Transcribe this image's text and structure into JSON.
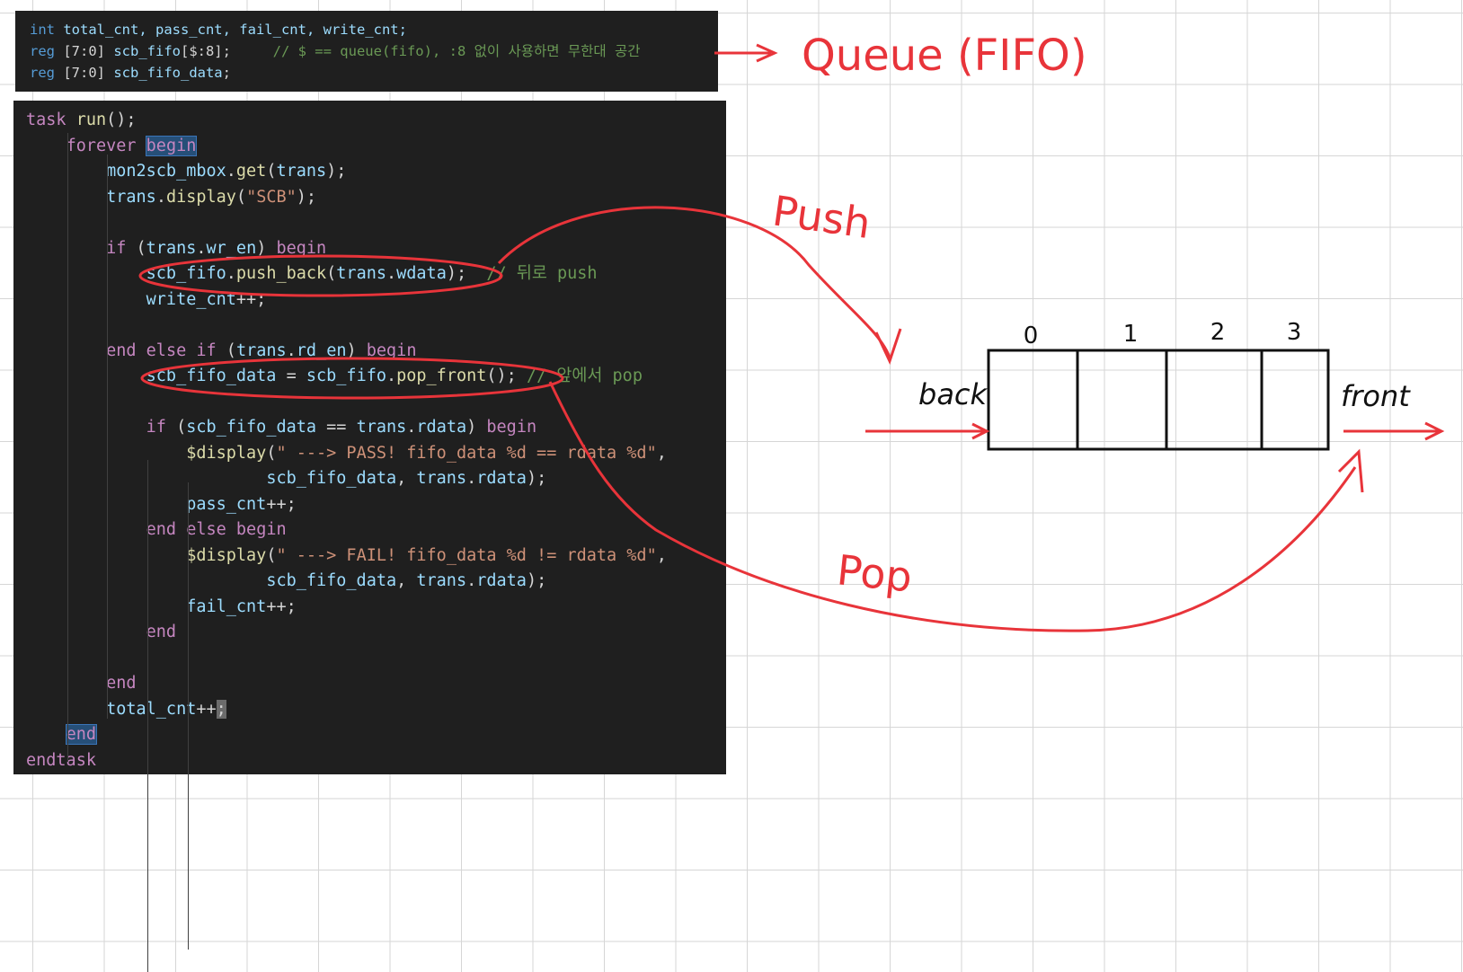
{
  "declarations": [
    [
      {
        "c": "kw",
        "t": "int"
      },
      {
        "c": "id",
        "t": " total_cnt, pass_cnt, fail_cnt, write_cnt;"
      }
    ],
    [
      {
        "c": "kw",
        "t": "reg"
      },
      {
        "c": "",
        "t": " [7:0] "
      },
      {
        "c": "id",
        "t": "scb_fifo"
      },
      {
        "c": "",
        "t": "[$:8];     "
      },
      {
        "c": "cm",
        "t": "// $ == queue(fifo), :8 없이 사용하면 무한대 공간"
      }
    ],
    [
      {
        "c": "kw",
        "t": "reg"
      },
      {
        "c": "",
        "t": " [7:0] "
      },
      {
        "c": "id",
        "t": "scb_fifo_data"
      },
      {
        "c": "",
        "t": ";"
      }
    ]
  ],
  "code_lines": [
    [
      {
        "c": "ctl",
        "t": "task"
      },
      {
        "c": "fn",
        "t": " run"
      },
      {
        "c": "",
        "t": "();"
      }
    ],
    [
      {
        "c": "",
        "t": "    "
      },
      {
        "c": "ctl",
        "t": "forever"
      },
      {
        "c": "",
        "t": " "
      },
      {
        "c": "ctl hl",
        "t": "begin"
      }
    ],
    [
      {
        "c": "",
        "t": "        "
      },
      {
        "c": "id",
        "t": "mon2scb_mbox"
      },
      {
        "c": "",
        "t": "."
      },
      {
        "c": "fn",
        "t": "get"
      },
      {
        "c": "",
        "t": "("
      },
      {
        "c": "id",
        "t": "trans"
      },
      {
        "c": "",
        "t": ");"
      }
    ],
    [
      {
        "c": "",
        "t": "        "
      },
      {
        "c": "id",
        "t": "trans"
      },
      {
        "c": "",
        "t": "."
      },
      {
        "c": "fn",
        "t": "display"
      },
      {
        "c": "",
        "t": "("
      },
      {
        "c": "str",
        "t": "\"SCB\""
      },
      {
        "c": "",
        "t": ");"
      }
    ],
    [],
    [
      {
        "c": "",
        "t": "        "
      },
      {
        "c": "ctl",
        "t": "if"
      },
      {
        "c": "",
        "t": " ("
      },
      {
        "c": "id",
        "t": "trans"
      },
      {
        "c": "",
        "t": "."
      },
      {
        "c": "id",
        "t": "wr_en"
      },
      {
        "c": "",
        "t": ") "
      },
      {
        "c": "ctl",
        "t": "begin"
      }
    ],
    [
      {
        "c": "",
        "t": "            "
      },
      {
        "c": "id",
        "t": "scb_fifo"
      },
      {
        "c": "",
        "t": "."
      },
      {
        "c": "fn",
        "t": "push_back"
      },
      {
        "c": "",
        "t": "("
      },
      {
        "c": "id",
        "t": "trans"
      },
      {
        "c": "",
        "t": "."
      },
      {
        "c": "id",
        "t": "wdata"
      },
      {
        "c": "",
        "t": ");  "
      },
      {
        "c": "cm",
        "t": "// 뒤로 push"
      }
    ],
    [
      {
        "c": "",
        "t": "            "
      },
      {
        "c": "id",
        "t": "write_cnt"
      },
      {
        "c": "",
        "t": "++;"
      }
    ],
    [],
    [
      {
        "c": "",
        "t": "        "
      },
      {
        "c": "ctl",
        "t": "end"
      },
      {
        "c": "",
        "t": " "
      },
      {
        "c": "ctl",
        "t": "else"
      },
      {
        "c": "",
        "t": " "
      },
      {
        "c": "ctl",
        "t": "if"
      },
      {
        "c": "",
        "t": " ("
      },
      {
        "c": "id",
        "t": "trans"
      },
      {
        "c": "",
        "t": "."
      },
      {
        "c": "id",
        "t": "rd_en"
      },
      {
        "c": "",
        "t": ") "
      },
      {
        "c": "ctl",
        "t": "begin"
      }
    ],
    [
      {
        "c": "",
        "t": "            "
      },
      {
        "c": "id",
        "t": "scb_fifo_data"
      },
      {
        "c": "",
        "t": " = "
      },
      {
        "c": "id",
        "t": "scb_fifo"
      },
      {
        "c": "",
        "t": "."
      },
      {
        "c": "fn",
        "t": "pop_front"
      },
      {
        "c": "",
        "t": "(); "
      },
      {
        "c": "cm",
        "t": "// 앞에서 pop"
      }
    ],
    [],
    [
      {
        "c": "",
        "t": "            "
      },
      {
        "c": "ctl",
        "t": "if"
      },
      {
        "c": "",
        "t": " ("
      },
      {
        "c": "id",
        "t": "scb_fifo_data"
      },
      {
        "c": "",
        "t": " == "
      },
      {
        "c": "id",
        "t": "trans"
      },
      {
        "c": "",
        "t": "."
      },
      {
        "c": "id",
        "t": "rdata"
      },
      {
        "c": "",
        "t": ") "
      },
      {
        "c": "ctl",
        "t": "begin"
      }
    ],
    [
      {
        "c": "",
        "t": "                "
      },
      {
        "c": "fn",
        "t": "$display"
      },
      {
        "c": "",
        "t": "("
      },
      {
        "c": "str",
        "t": "\" ---> PASS! fifo_data %d == rdata %d\""
      },
      {
        "c": "",
        "t": ","
      }
    ],
    [
      {
        "c": "",
        "t": "                        "
      },
      {
        "c": "id",
        "t": "scb_fifo_data"
      },
      {
        "c": "",
        "t": ", "
      },
      {
        "c": "id",
        "t": "trans"
      },
      {
        "c": "",
        "t": "."
      },
      {
        "c": "id",
        "t": "rdata"
      },
      {
        "c": "",
        "t": ");"
      }
    ],
    [
      {
        "c": "",
        "t": "                "
      },
      {
        "c": "id",
        "t": "pass_cnt"
      },
      {
        "c": "",
        "t": "++;"
      }
    ],
    [
      {
        "c": "",
        "t": "            "
      },
      {
        "c": "ctl",
        "t": "end"
      },
      {
        "c": "",
        "t": " "
      },
      {
        "c": "ctl",
        "t": "else"
      },
      {
        "c": "",
        "t": " "
      },
      {
        "c": "ctl",
        "t": "begin"
      }
    ],
    [
      {
        "c": "",
        "t": "                "
      },
      {
        "c": "fn",
        "t": "$display"
      },
      {
        "c": "",
        "t": "("
      },
      {
        "c": "str",
        "t": "\" ---> FAIL! fifo_data %d != rdata %d\""
      },
      {
        "c": "",
        "t": ","
      }
    ],
    [
      {
        "c": "",
        "t": "                        "
      },
      {
        "c": "id",
        "t": "scb_fifo_data"
      },
      {
        "c": "",
        "t": ", "
      },
      {
        "c": "id",
        "t": "trans"
      },
      {
        "c": "",
        "t": "."
      },
      {
        "c": "id",
        "t": "rdata"
      },
      {
        "c": "",
        "t": ");"
      }
    ],
    [
      {
        "c": "",
        "t": "                "
      },
      {
        "c": "id",
        "t": "fail_cnt"
      },
      {
        "c": "",
        "t": "++;"
      }
    ],
    [
      {
        "c": "",
        "t": "            "
      },
      {
        "c": "ctl",
        "t": "end"
      }
    ],
    [],
    [
      {
        "c": "",
        "t": "        "
      },
      {
        "c": "ctl",
        "t": "end"
      }
    ],
    [
      {
        "c": "",
        "t": "        "
      },
      {
        "c": "id",
        "t": "total_cnt"
      },
      {
        "c": "",
        "t": "++"
      },
      {
        "c": "cur",
        "t": ";"
      }
    ],
    [
      {
        "c": "",
        "t": "    "
      },
      {
        "c": "ctl hl",
        "t": "end"
      }
    ],
    [
      {
        "c": "ctl",
        "t": "endtask"
      }
    ]
  ],
  "annotations": {
    "queue_label": "Queue (FIFO)",
    "push_label": "Push",
    "pop_label": "Pop",
    "back_label": "back",
    "front_label": "front",
    "slot_indices": [
      "0",
      "1",
      "2",
      "3"
    ],
    "ink_color": "#e8343a",
    "box_color": "#111111"
  }
}
